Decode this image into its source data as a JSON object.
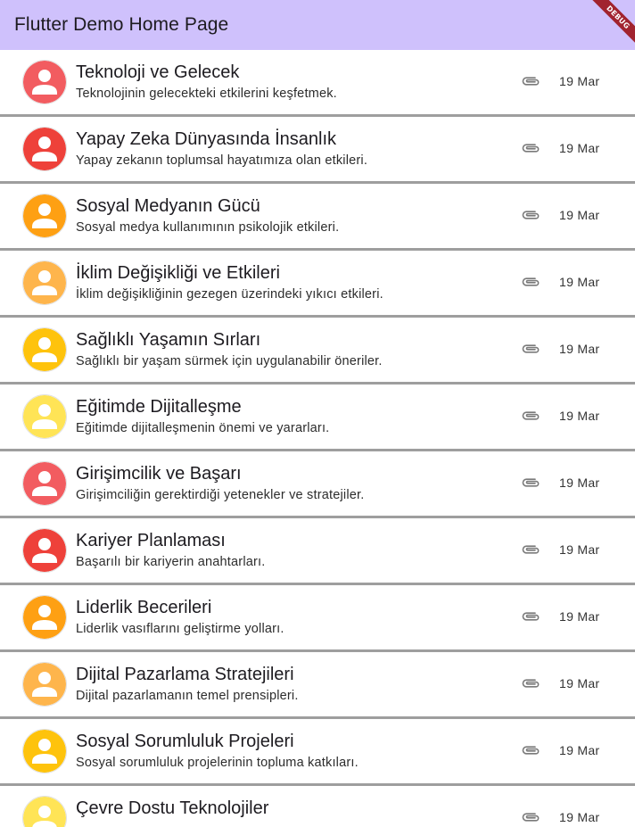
{
  "appbar": {
    "title": "Flutter Demo Home Page",
    "color": "#cfc1fc"
  },
  "debug_banner": {
    "label": "DEBUG",
    "color": "#a1232f"
  },
  "items": [
    {
      "title": "Teknoloji ve Gelecek",
      "subtitle": "Teknolojinin gelecekteki etkilerini keşfetmek.",
      "date": "19 Mar",
      "avatar_color": "#f25c60",
      "icon": "person-icon",
      "trailing_icon": "attachment-icon"
    },
    {
      "title": "Yapay Zeka Dünyasında İnsanlık",
      "subtitle": "Yapay zekanın toplumsal hayatımıza olan etkileri.",
      "date": "19 Mar",
      "avatar_color": "#ee413a",
      "icon": "person-icon",
      "trailing_icon": "attachment-icon"
    },
    {
      "title": "Sosyal Medyanın Gücü",
      "subtitle": "Sosyal medya kullanımının psikolojik etkileri.",
      "date": "19 Mar",
      "avatar_color": "#fea013",
      "icon": "person-icon",
      "trailing_icon": "attachment-icon"
    },
    {
      "title": "İklim Değişikliği ve Etkileri",
      "subtitle": "İklim değişikliğinin gezegen üzerindeki yıkıcı etkileri.",
      "date": "19 Mar",
      "avatar_color": "#feb54c",
      "icon": "person-icon",
      "trailing_icon": "attachment-icon"
    },
    {
      "title": "Sağlıklı Yaşamın Sırları",
      "subtitle": "Sağlıklı bir yaşam sürmek için uygulanabilir öneriler.",
      "date": "19 Mar",
      "avatar_color": "#fec30c",
      "icon": "person-icon",
      "trailing_icon": "attachment-icon"
    },
    {
      "title": "Eğitimde Dijitalleşme",
      "subtitle": "Eğitimde dijitalleşmenin önemi ve yararları.",
      "date": "19 Mar",
      "avatar_color": "#ffe456",
      "icon": "person-icon",
      "trailing_icon": "attachment-icon"
    },
    {
      "title": "Girişimcilik ve Başarı",
      "subtitle": "Girişimciliğin gerektirdiği yetenekler ve stratejiler.",
      "date": "19 Mar",
      "avatar_color": "#f25c60",
      "icon": "person-icon",
      "trailing_icon": "attachment-icon"
    },
    {
      "title": "Kariyer Planlaması",
      "subtitle": "Başarılı bir kariyerin anahtarları.",
      "date": "19 Mar",
      "avatar_color": "#ee413a",
      "icon": "person-icon",
      "trailing_icon": "attachment-icon"
    },
    {
      "title": "Liderlik Becerileri",
      "subtitle": "Liderlik vasıflarını geliştirme yolları.",
      "date": "19 Mar",
      "avatar_color": "#fea013",
      "icon": "person-icon",
      "trailing_icon": "attachment-icon"
    },
    {
      "title": "Dijital Pazarlama Stratejileri",
      "subtitle": "Dijital pazarlamanın temel prensipleri.",
      "date": "19 Mar",
      "avatar_color": "#feb54c",
      "icon": "person-icon",
      "trailing_icon": "attachment-icon"
    },
    {
      "title": "Sosyal Sorumluluk Projeleri",
      "subtitle": "Sosyal sorumluluk projelerinin topluma katkıları.",
      "date": "19 Mar",
      "avatar_color": "#fec30c",
      "icon": "person-icon",
      "trailing_icon": "attachment-icon"
    },
    {
      "title": "Çevre Dostu Teknolojiler",
      "subtitle": "",
      "date": "19 Mar",
      "avatar_color": "#ffe456",
      "icon": "person-icon",
      "trailing_icon": "attachment-icon"
    }
  ]
}
